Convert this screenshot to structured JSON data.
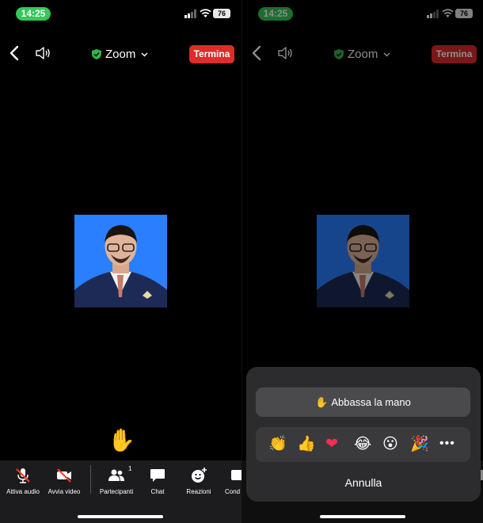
{
  "status": {
    "time": "14:25",
    "battery": "76"
  },
  "nav": {
    "title": "Zoom",
    "end_label": "Termina"
  },
  "toolbar": {
    "audio_label": "Attiva audio",
    "video_label": "Avvia video",
    "participants_label": "Partecipanti",
    "participants_count": "1",
    "chat_label": "Chat",
    "reactions_label": "Reazioni",
    "more_label": "Cond"
  },
  "reaction_sheet": {
    "lower_hand_label": "Abbassa la mano",
    "cancel_label": "Annulla",
    "reactions": [
      "clap",
      "thumbs-up",
      "heart",
      "laugh",
      "surprised",
      "party"
    ]
  },
  "colors": {
    "status_pill": "#34c759",
    "end_button": "#e02b2b",
    "avatar_bg": "#2a7fff",
    "toolbar_bg": "#1c1c1e"
  }
}
